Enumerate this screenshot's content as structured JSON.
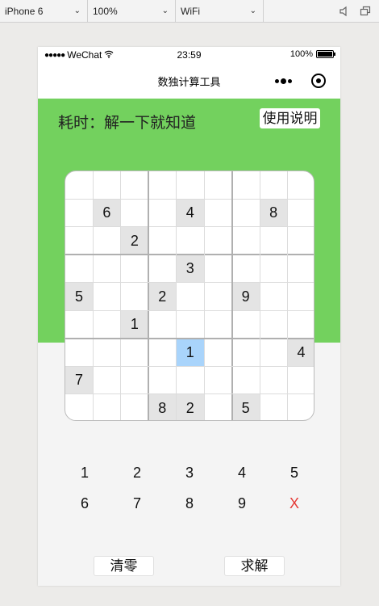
{
  "devtools": {
    "device": "iPhone 6",
    "zoom": "100%",
    "network": "WiFi"
  },
  "status_bar": {
    "carrier": "WeChat",
    "time": "23:59",
    "battery": "100%"
  },
  "navbar": {
    "title": "数独计算工具"
  },
  "header": {
    "timer_text": "耗时：解一下就知道",
    "help_label": "使用说明"
  },
  "board": {
    "rows": [
      [
        "",
        "",
        "",
        "",
        "",
        "",
        "",
        "",
        ""
      ],
      [
        "",
        "6",
        "",
        "",
        "4",
        "",
        "",
        "8",
        ""
      ],
      [
        "",
        "",
        "2",
        "",
        "",
        "",
        "",
        "",
        ""
      ],
      [
        "",
        "",
        "",
        "",
        "3",
        "",
        "",
        "",
        ""
      ],
      [
        "5",
        "",
        "",
        "2",
        "",
        "",
        "9",
        "",
        ""
      ],
      [
        "",
        "",
        "1",
        "",
        "",
        "",
        "",
        "",
        ""
      ],
      [
        "",
        "",
        "",
        "",
        "1",
        "",
        "",
        "",
        "4"
      ],
      [
        "7",
        "",
        "",
        "",
        "",
        "",
        "",
        "",
        ""
      ],
      [
        "",
        "",
        "",
        "8",
        "2",
        "",
        "5",
        "",
        ""
      ]
    ],
    "selected": {
      "row": 6,
      "col": 4
    }
  },
  "keypad": {
    "keys": [
      "1",
      "2",
      "3",
      "4",
      "5",
      "6",
      "7",
      "8",
      "9",
      "X"
    ]
  },
  "actions": {
    "clear_label": "清零",
    "solve_label": "求解"
  },
  "colors": {
    "header_green": "#73d15e",
    "selected_cell": "#a9d4fb",
    "given_cell": "#e4e4e4",
    "clear_key": "#e53935"
  }
}
